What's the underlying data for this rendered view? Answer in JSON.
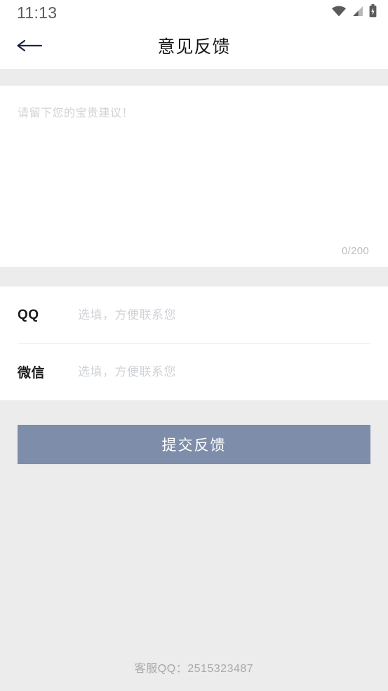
{
  "status_bar": {
    "time": "11:13",
    "icons": [
      "wifi-icon",
      "signal-icon",
      "battery-charging-icon"
    ]
  },
  "header": {
    "title": "意见反馈",
    "back_icon": "arrow-left-icon"
  },
  "feedback": {
    "placeholder": "请留下您的宝贵建议！",
    "value": "",
    "char_counter": "0/200",
    "max_length": 200
  },
  "contact": {
    "rows": [
      {
        "label": "QQ",
        "placeholder": "选填，方便联系您",
        "value": ""
      },
      {
        "label": "微信",
        "placeholder": "选填，方便联系您",
        "value": ""
      }
    ]
  },
  "submit": {
    "label": "提交反馈",
    "color": "#7d8daa"
  },
  "footer": {
    "service_qq": "客服QQ：2515323487"
  },
  "colors": {
    "page_background": "#ececec",
    "card_background": "#ffffff",
    "accent": "#7d8daa",
    "title_text": "#161616",
    "placeholder_text": "#cfd2d6",
    "back_arrow": "#1f2440"
  }
}
